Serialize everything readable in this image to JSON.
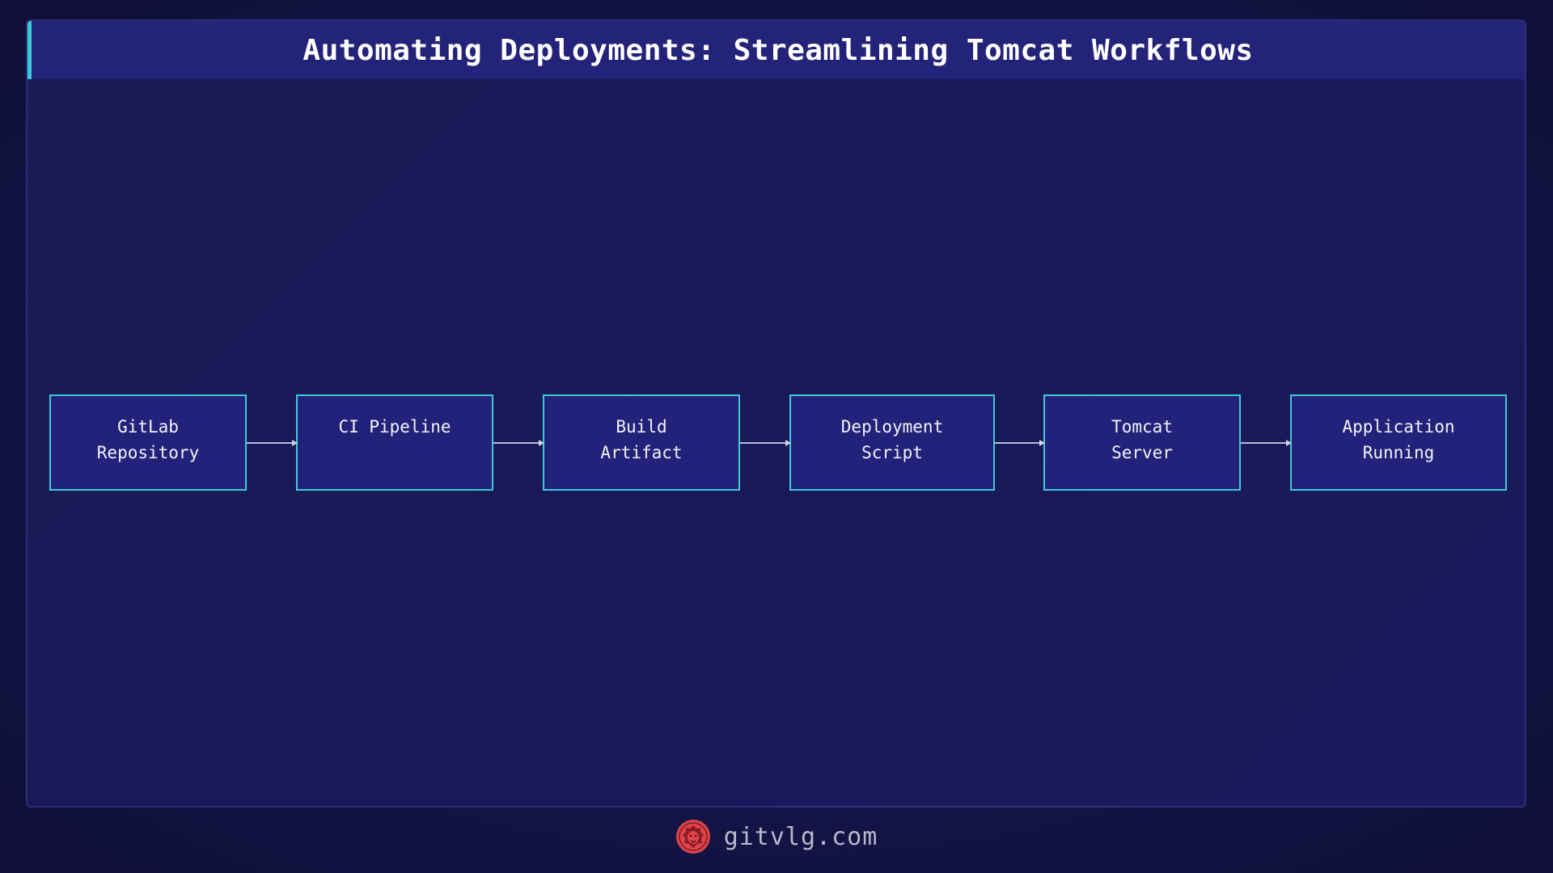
{
  "title": "Automating Deployments: Streamlining Tomcat Workflows",
  "diagram": {
    "nodes": [
      {
        "id": "gitlab",
        "label": "GitLab\nRepository"
      },
      {
        "id": "ci",
        "label": "CI Pipeline"
      },
      {
        "id": "build",
        "label": "Build\nArtifact"
      },
      {
        "id": "deploy",
        "label": "Deployment\nScript"
      },
      {
        "id": "tomcat",
        "label": "Tomcat\nServer"
      },
      {
        "id": "app",
        "label": "Application\nRunning"
      }
    ],
    "edges": [
      {
        "from": "gitlab",
        "to": "ci"
      },
      {
        "from": "ci",
        "to": "build"
      },
      {
        "from": "build",
        "to": "deploy"
      },
      {
        "from": "deploy",
        "to": "tomcat"
      },
      {
        "from": "tomcat",
        "to": "app"
      }
    ]
  },
  "footer": {
    "text": "gitvlg.com",
    "logo_icon": "lion-logo-icon"
  },
  "colors": {
    "background": "#141448",
    "node_fill": "#23227a",
    "node_border": "#3ec9d6",
    "title_bar": "#24237a",
    "accent": "#3ec9d6",
    "logo": "#e0434a"
  }
}
